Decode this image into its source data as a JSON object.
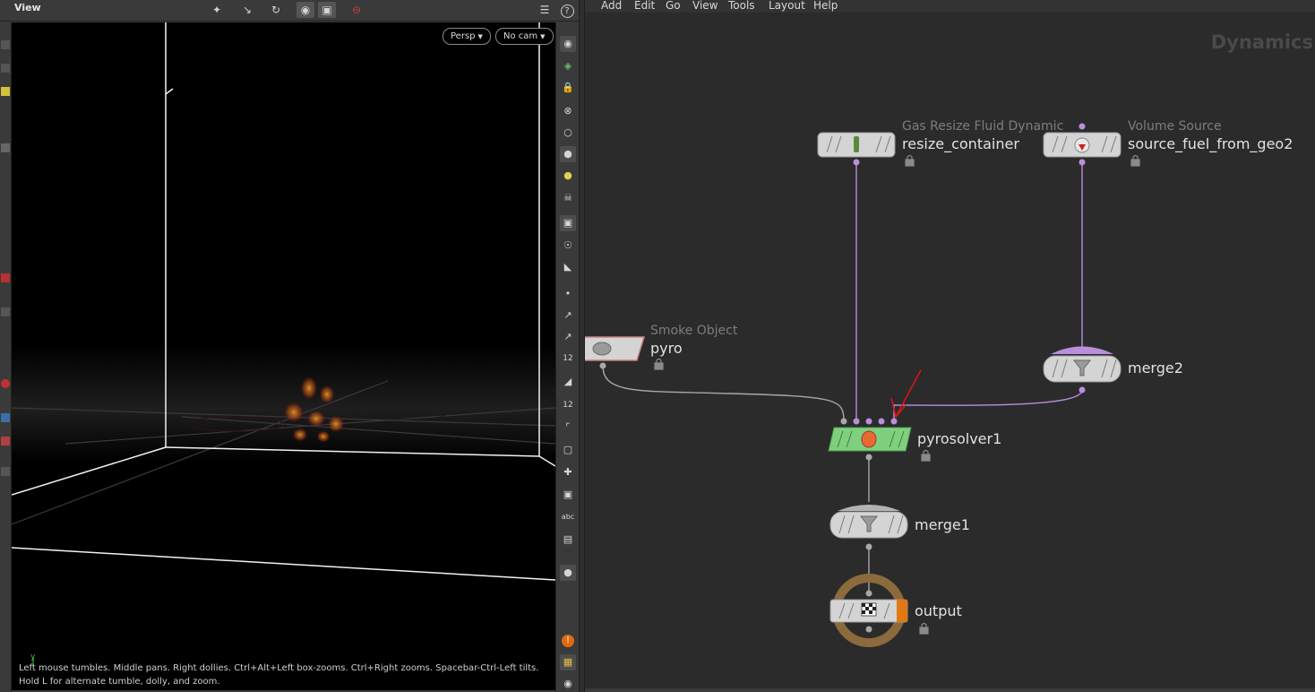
{
  "viewer": {
    "title": "View",
    "persp_label": "Persp",
    "camera_label": "No cam",
    "axis_label": "y",
    "help_text": "Left mouse tumbles. Middle pans. Right dollies. Ctrl+Alt+Left box-zooms. Ctrl+Right zooms. Spacebar-Ctrl-Left tilts. Hold L for alternate tumble, dolly, and zoom.",
    "toolbar_icons": [
      "select-icon",
      "transform-icon",
      "handle-icon",
      "snap-icon",
      "camera-icon",
      "stop-icon",
      "display-options-icon",
      "help-icon"
    ],
    "help_glyph": "?",
    "right_strip_labels": {
      "point_numbers": "12",
      "prim_numbers": "12",
      "text_label": "abc"
    }
  },
  "network": {
    "menu": [
      "Add",
      "Edit",
      "Go",
      "View",
      "Tools",
      "Layout",
      "Help"
    ],
    "context_title": "Dynamics",
    "nodes": [
      {
        "id": "resize_container",
        "type": "Gas Resize Fluid Dynamic",
        "name": "resize_container"
      },
      {
        "id": "source_fuel_from_geo2",
        "type": "Volume Source",
        "name": "source_fuel_from_geo2"
      },
      {
        "id": "pyro",
        "type": "Smoke Object",
        "name": "pyro"
      },
      {
        "id": "merge2",
        "type": "",
        "name": "merge2"
      },
      {
        "id": "pyrosolver1",
        "type": "",
        "name": "pyrosolver1"
      },
      {
        "id": "merge1",
        "type": "",
        "name": "merge1"
      },
      {
        "id": "output",
        "type": "",
        "name": "output"
      }
    ],
    "colors": {
      "wire": "#b98fdc",
      "wire_gray": "#a8a8a8",
      "solver_green": "#7ed07e",
      "node_gray": "#d4d4d4",
      "annotation_red": "#e01515",
      "output_ring": "#8b6a3c",
      "output_flag": "#e07814"
    }
  }
}
